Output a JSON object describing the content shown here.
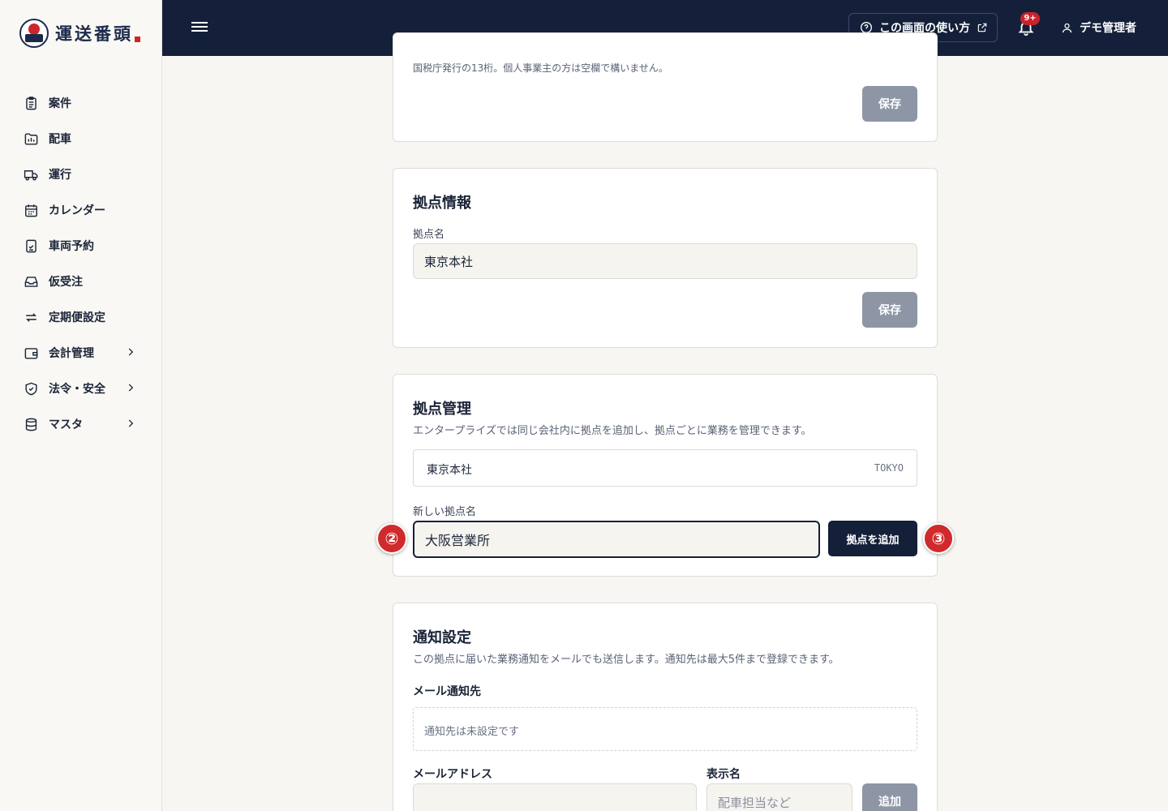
{
  "app": {
    "logo_text": "運送番頭"
  },
  "sidebar": {
    "items": [
      {
        "label": "案件",
        "icon": "clipboard-icon"
      },
      {
        "label": "配車",
        "icon": "folder-chart-icon"
      },
      {
        "label": "運行",
        "icon": "truck-icon"
      },
      {
        "label": "カレンダー",
        "icon": "calendar-icon"
      },
      {
        "label": "車両予約",
        "icon": "clipboard-check-icon"
      },
      {
        "label": "仮受注",
        "icon": "inbox-icon"
      },
      {
        "label": "定期便設定",
        "icon": "repeat-icon"
      },
      {
        "label": "会計管理",
        "icon": "wallet-icon",
        "has_children": true
      },
      {
        "label": "法令・安全",
        "icon": "shield-check-icon",
        "has_children": true
      },
      {
        "label": "マスタ",
        "icon": "database-icon",
        "has_children": true
      }
    ]
  },
  "topbar": {
    "help_label": "この画面の使い方",
    "notification_badge": "9+",
    "user_label": "デモ管理者"
  },
  "company_card": {
    "hint": "国税庁発行の13桁。個人事業主の方は空欄で構いません。",
    "save_label": "保存"
  },
  "location_info": {
    "title": "拠点情報",
    "name_label": "拠点名",
    "name_value": "東京本社",
    "save_label": "保存"
  },
  "location_management": {
    "title": "拠点管理",
    "description": "エンタープライズでは同じ会社内に拠点を追加し、拠点ごとに業務を管理できます。",
    "locations": [
      {
        "name": "東京本社",
        "code": "TOKYO"
      }
    ],
    "new_label": "新しい拠点名",
    "new_value": "大阪営業所",
    "add_label": "拠点を追加",
    "step_input": "②",
    "step_button": "③"
  },
  "notification_settings": {
    "title": "通知設定",
    "description": "この拠点に届いた業務通知をメールでも送信します。通知先は最大5件まで登録できます。",
    "recipients_label": "メール通知先",
    "empty_text": "通知先は未設定です",
    "email_label": "メールアドレス",
    "email_value": "",
    "display_label": "表示名",
    "display_placeholder": "配車担当など",
    "add_label": "追加"
  },
  "colors": {
    "navy": "#14203a",
    "accent_red": "#d02a2d",
    "disabled_gray": "#8e96a6"
  }
}
